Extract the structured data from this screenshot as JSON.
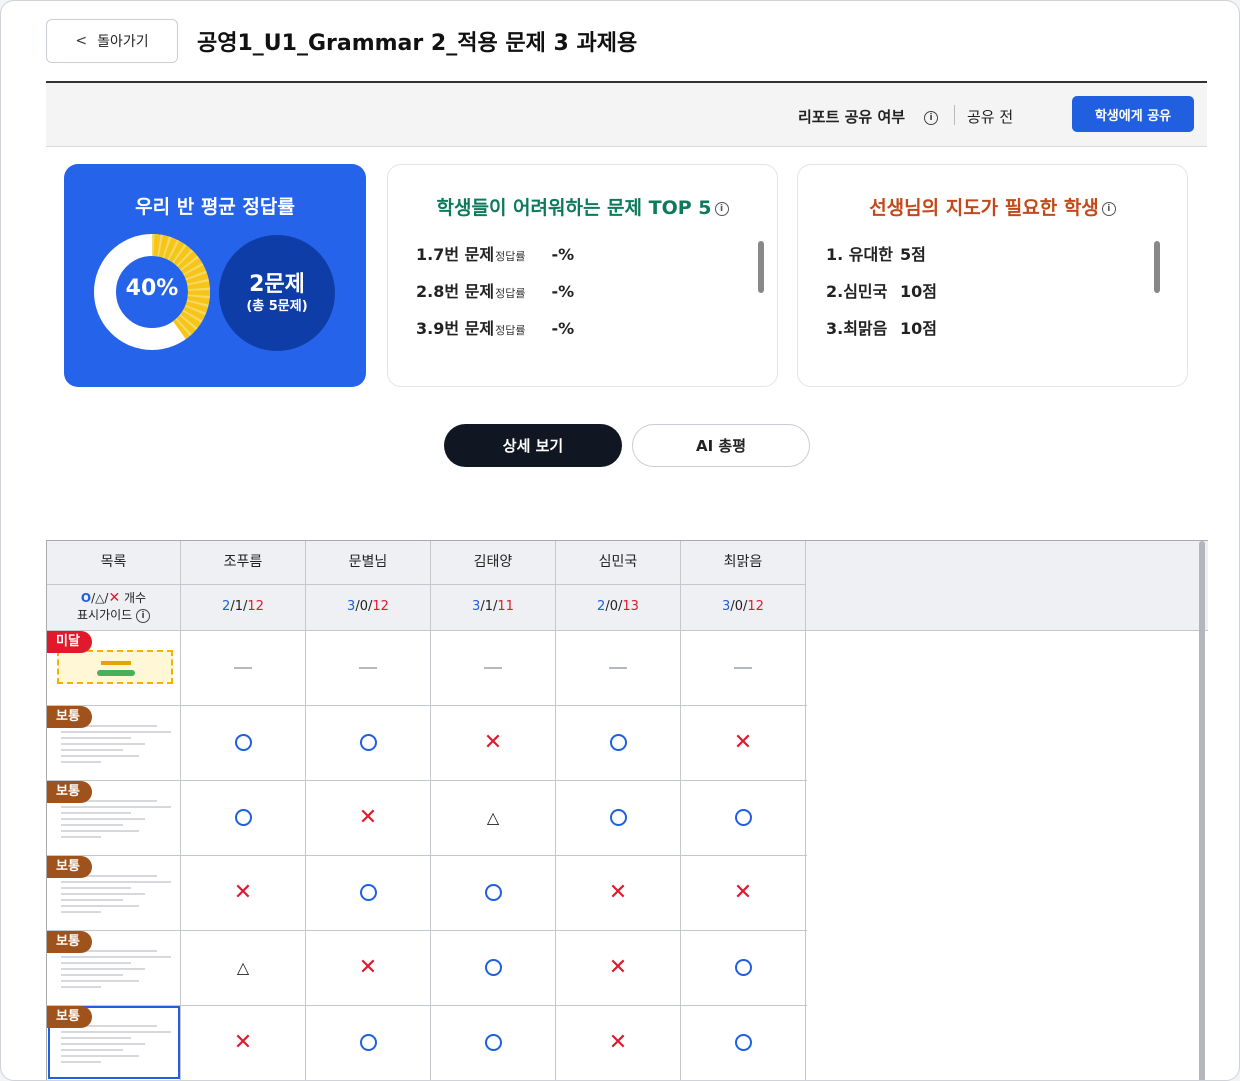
{
  "header": {
    "back_label": "돌아가기",
    "title": "공영1_U1_Grammar 2_적용 문제 3 과제용"
  },
  "share": {
    "label": "리포트 공유 여부",
    "status": "공유 전",
    "button": "학생에게 공유"
  },
  "average": {
    "title": "우리 반 평균 정답률",
    "percent_label": "40%",
    "percent_value": 40,
    "count_main": "2문제",
    "count_sub": "(총 5문제)"
  },
  "hard_questions": {
    "title": "학생들이 어려워하는 문제 TOP 5",
    "items": [
      {
        "label": "1.7번 문제",
        "sub": "정답률",
        "value": "-%"
      },
      {
        "label": "2.8번 문제",
        "sub": "정답률",
        "value": "-%"
      },
      {
        "label": "3.9번 문제",
        "sub": "정답률",
        "value": "-%"
      }
    ]
  },
  "need_guidance": {
    "title": "선생님의 지도가 필요한 학생",
    "items": [
      {
        "label": "1. 유대한",
        "value": "5점"
      },
      {
        "label": "2.심민국",
        "value": "10점"
      },
      {
        "label": "3.최맑음",
        "value": "10점"
      }
    ]
  },
  "view_tabs": {
    "detail": "상세 보기",
    "ai": "AI 총평"
  },
  "table": {
    "list_header": "목록",
    "guide_line1": "개수",
    "guide_line2": "표시가이드",
    "guide_o": "O",
    "guide_slash": "/",
    "guide_t": "△",
    "guide_x": "✕",
    "students": [
      {
        "name": "조푸름",
        "o": "2",
        "t": "1",
        "x": "12"
      },
      {
        "name": "문별님",
        "o": "3",
        "t": "0",
        "x": "12"
      },
      {
        "name": "김태양",
        "o": "3",
        "t": "1",
        "x": "11"
      },
      {
        "name": "심민국",
        "o": "2",
        "t": "0",
        "x": "13"
      },
      {
        "name": "최맑음",
        "o": "3",
        "t": "0",
        "x": "12"
      }
    ],
    "rows": [
      {
        "level": "미달",
        "level_type": "low",
        "thumb": "image",
        "marks": [
          "-",
          "-",
          "-",
          "-",
          "-"
        ]
      },
      {
        "level": "보통",
        "level_type": "mid",
        "thumb": "lines",
        "marks": [
          "o",
          "o",
          "x",
          "o",
          "x"
        ]
      },
      {
        "level": "보통",
        "level_type": "mid",
        "thumb": "lines",
        "marks": [
          "o",
          "x",
          "t",
          "o",
          "o"
        ]
      },
      {
        "level": "보통",
        "level_type": "mid",
        "thumb": "lines",
        "marks": [
          "x",
          "o",
          "o",
          "x",
          "x"
        ]
      },
      {
        "level": "보통",
        "level_type": "mid",
        "thumb": "lines",
        "marks": [
          "t",
          "x",
          "o",
          "x",
          "o"
        ]
      },
      {
        "level": "보통",
        "level_type": "mid",
        "thumb": "lines",
        "marks": [
          "x",
          "o",
          "o",
          "x",
          "o"
        ]
      }
    ]
  },
  "colors": {
    "primary": "#2563eb",
    "dark_blue": "#0e3da8",
    "correct": "#1f5fe0",
    "wrong": "#e0192d",
    "donut_fill": "#f5c518",
    "badge_low": "#e0192d",
    "badge_mid": "#a0521d"
  }
}
